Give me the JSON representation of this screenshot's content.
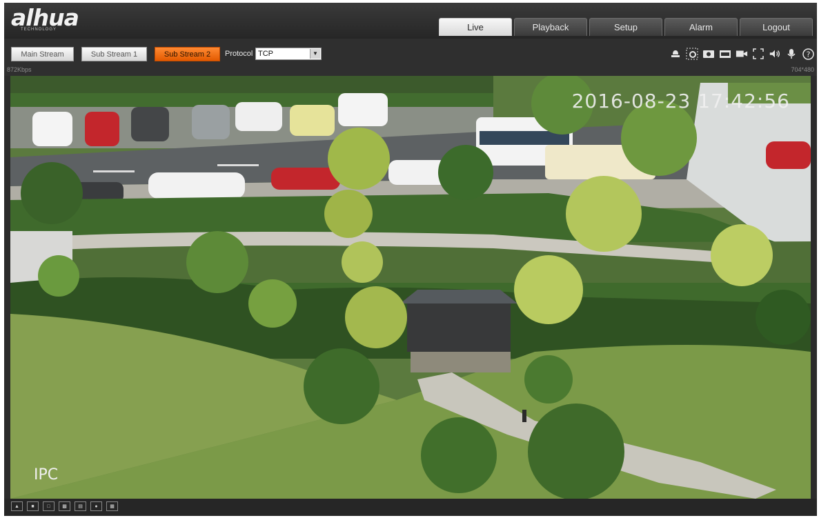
{
  "brand": {
    "logo_text": "alhua",
    "logo_sub": "TECHNOLOGY"
  },
  "nav": {
    "tabs": [
      {
        "label": "Live",
        "active": true
      },
      {
        "label": "Playback",
        "active": false
      },
      {
        "label": "Setup",
        "active": false
      },
      {
        "label": "Alarm",
        "active": false
      },
      {
        "label": "Logout",
        "active": false
      }
    ]
  },
  "toolbar": {
    "streams": [
      {
        "label": "Main Stream",
        "active": false
      },
      {
        "label": "Sub Stream 1",
        "active": false
      },
      {
        "label": "Sub Stream 2",
        "active": true
      }
    ],
    "protocol_label": "Protocol",
    "protocol_value": "TCP",
    "bitrate": "872Kbps",
    "resolution": "704*480",
    "icons": [
      "alarm-output-icon",
      "digital-zoom-icon",
      "snapshot-icon",
      "triple-snapshot-icon",
      "record-icon",
      "fullscreen-icon",
      "audio-icon",
      "talk-icon",
      "help-icon"
    ]
  },
  "video": {
    "timestamp": "2016-08-23 17:42:56",
    "channel_label": "IPC"
  },
  "bottom": {
    "icons": [
      "ptz-icon",
      "image-adjust-icon",
      "original-size-icon",
      "ratio-icon",
      "fluency-icon",
      "rule-info-icon",
      "stretch-icon"
    ]
  },
  "colors": {
    "accent": "#ff7a1a",
    "active_tab": "#efefef",
    "chrome": "#2b2b2b"
  }
}
